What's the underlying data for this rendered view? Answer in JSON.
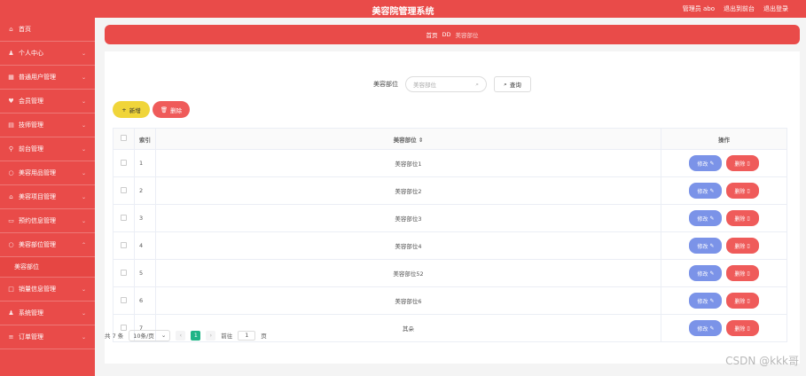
{
  "header": {
    "title": "美容院管理系统",
    "admin": "管理员 abo",
    "goto_front": "退出到前台",
    "logout": "退出登录"
  },
  "sidebar": {
    "items": [
      {
        "label": "首页",
        "icon": "home-icon"
      },
      {
        "label": "个人中心",
        "icon": "user-icon"
      },
      {
        "label": "普通用户管理",
        "icon": "grid-icon"
      },
      {
        "label": "会员管理",
        "icon": "heart-icon"
      },
      {
        "label": "技师管理",
        "icon": "table-icon"
      },
      {
        "label": "前台管理",
        "icon": "pin-icon"
      },
      {
        "label": "美容用品管理",
        "icon": "circle-icon"
      },
      {
        "label": "美容项目管理",
        "icon": "bank-icon"
      },
      {
        "label": "预约信息管理",
        "icon": "doc-icon"
      },
      {
        "label": "美容部位管理",
        "icon": "circle-icon"
      }
    ],
    "sub_item": "美容部位",
    "items_after": [
      {
        "label": "销量信息管理",
        "icon": "box-icon"
      },
      {
        "label": "系统管理",
        "icon": "user-icon"
      },
      {
        "label": "订单管理",
        "icon": "list-icon"
      }
    ]
  },
  "breadcrumb": {
    "home": "首页",
    "sep": "DD",
    "current": "美容部位"
  },
  "search": {
    "label": "美容部位",
    "placeholder": "美容部位",
    "button": "查询"
  },
  "toolbar": {
    "add_label": "新增",
    "delete_label": "删除"
  },
  "table": {
    "columns": [
      "索引",
      "美容部位",
      "操作"
    ],
    "rows": [
      {
        "index": "1",
        "name": "美容部位1"
      },
      {
        "index": "2",
        "name": "美容部位2"
      },
      {
        "index": "3",
        "name": "美容部位3"
      },
      {
        "index": "4",
        "name": "美容部位4"
      },
      {
        "index": "5",
        "name": "美容部位52"
      },
      {
        "index": "6",
        "name": "美容部位6"
      },
      {
        "index": "7",
        "name": "其朵"
      }
    ],
    "edit_label": "修改",
    "remove_label": "删除"
  },
  "pagination": {
    "total": "共 7 条",
    "page_size": "10条/页",
    "current_page": "1",
    "goto_prefix": "前往",
    "goto_value": "1",
    "goto_suffix": "页"
  },
  "watermark": "CSDN @kkk哥"
}
